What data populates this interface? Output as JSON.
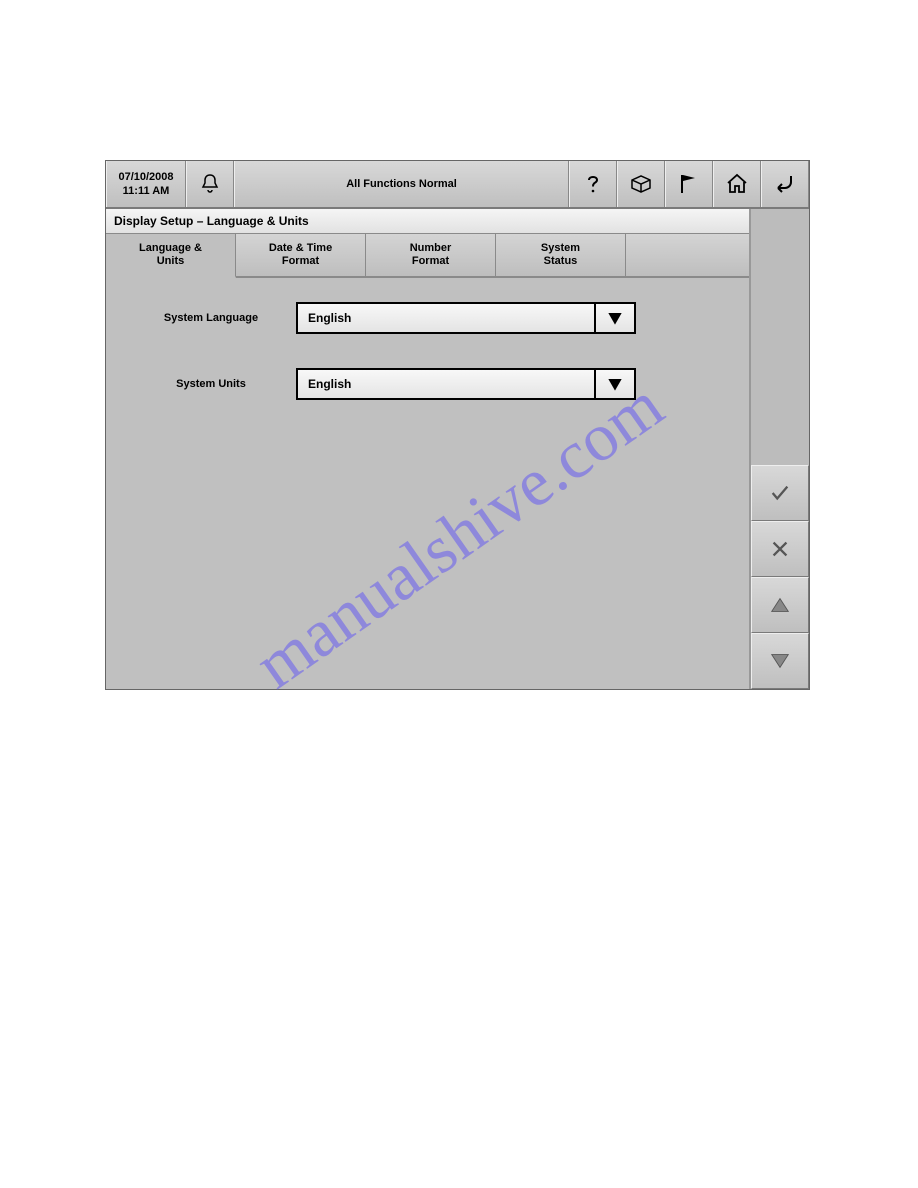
{
  "header": {
    "date": "07/10/2008",
    "time": "11:11 AM",
    "status": "All Functions Normal"
  },
  "breadcrumb": "Display Setup – Language & Units",
  "tabs": {
    "0": {
      "line1": "Language &",
      "line2": "Units"
    },
    "1": {
      "line1": "Date & Time",
      "line2": "Format"
    },
    "2": {
      "line1": "Number",
      "line2": "Format"
    },
    "3": {
      "line1": "System",
      "line2": "Status"
    }
  },
  "fields": {
    "language": {
      "label": "System Language",
      "value": "English"
    },
    "units": {
      "label": "System Units",
      "value": "English"
    }
  },
  "watermark": "manualshive.com"
}
